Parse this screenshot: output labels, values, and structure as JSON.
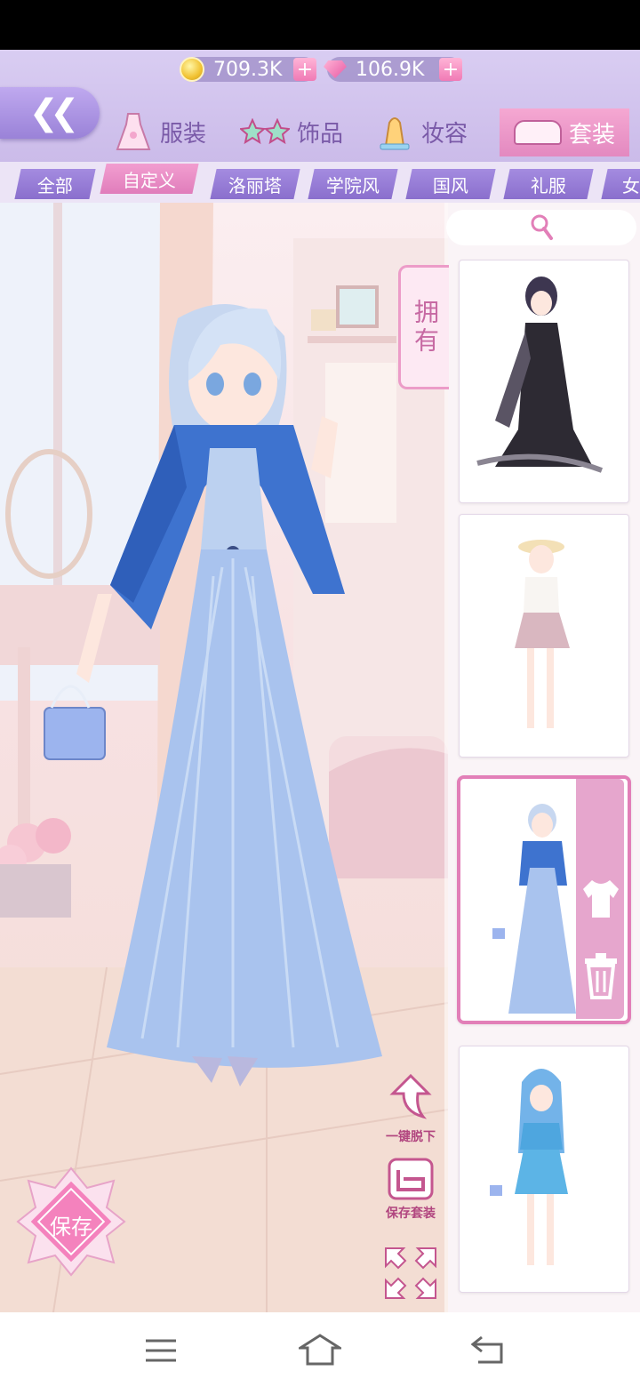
{
  "header": {
    "coins": "709.3K",
    "gems": "106.9K",
    "plus": "+"
  },
  "main_tabs": [
    {
      "label": "服装",
      "icon": "dress-icon"
    },
    {
      "label": "饰品",
      "icon": "glasses-icon"
    },
    {
      "label": "妆容",
      "icon": "makeup-icon"
    },
    {
      "label": "套装",
      "icon": "crown-icon",
      "active": true
    }
  ],
  "categories": [
    "全部",
    "自定义",
    "洛丽塔",
    "学院风",
    "国风",
    "礼服",
    "女"
  ],
  "active_category": "自定义",
  "panel": {
    "owned_label": "拥有"
  },
  "actions": {
    "undress_all": "一键脱下",
    "save_outfit": "保存套装",
    "save": "保存"
  },
  "colors": {
    "accent_pink": "#e27fb8",
    "accent_purple": "#9a82d8",
    "dress_blue": "#a9c3ee"
  }
}
